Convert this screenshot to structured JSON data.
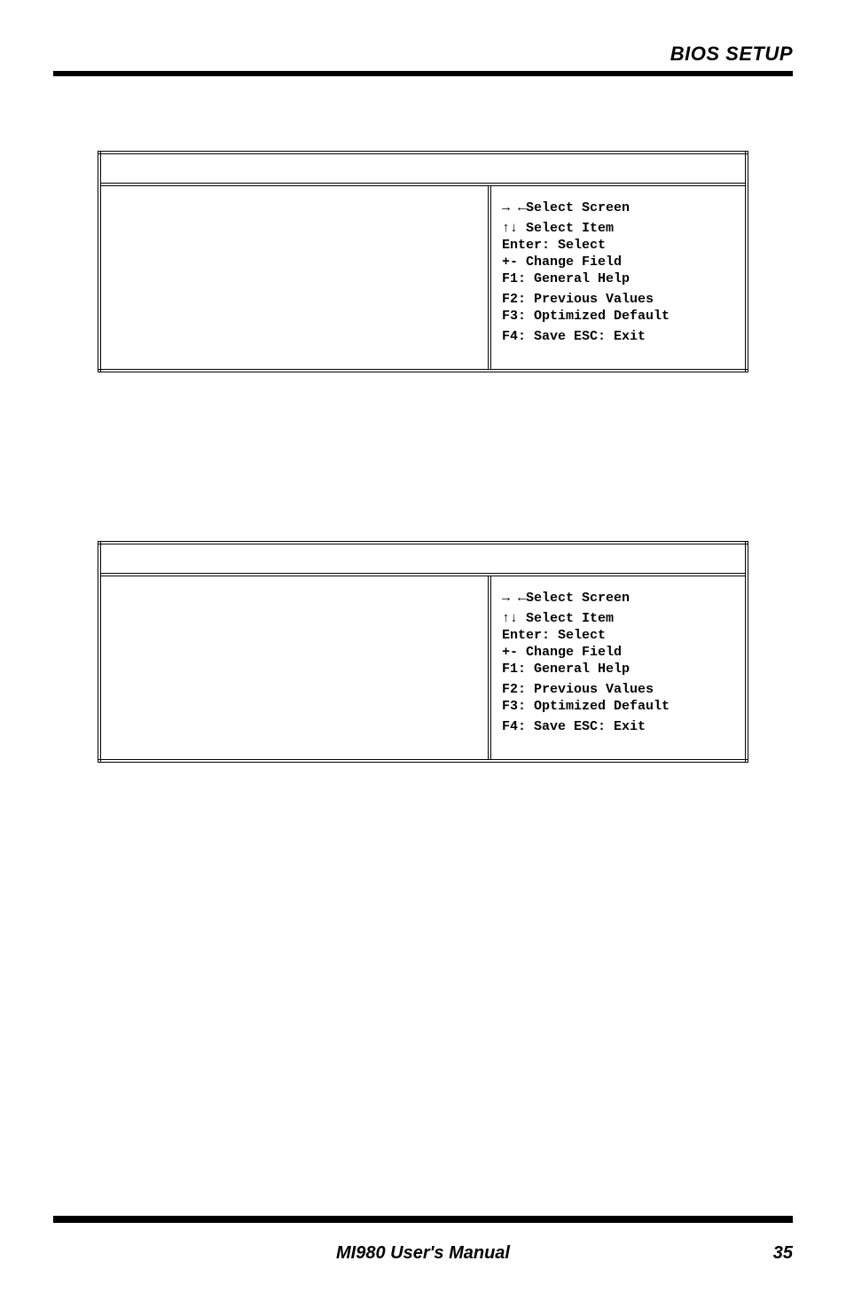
{
  "header": {
    "title": "BIOS SETUP"
  },
  "help": {
    "select_screen": "→ ←Select Screen",
    "select_item": "↑↓ Select Item",
    "enter": "Enter: Select",
    "change_field": "+-  Change Field",
    "f1": "F1: General Help",
    "f2": "F2: Previous Values",
    "f3": "F3: Optimized Default",
    "f4": "F4: Save  ESC: Exit"
  },
  "footer": {
    "manual": "MI980 User's Manual",
    "page": "35"
  }
}
